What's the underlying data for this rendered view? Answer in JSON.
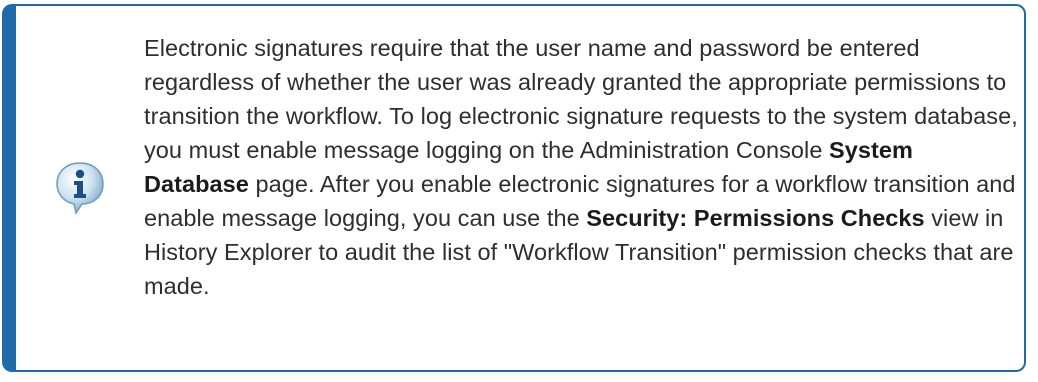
{
  "note": {
    "icon": "info-speech-bubble-icon",
    "accent_color": "#1f6aa8",
    "segments": [
      "Electronic signatures require that the user name and password be entered regardless of whether the user was already granted the appropriate permissions to transition the workflow. To log electronic signature requests to the system database, you must enable message logging on the Administration Console ",
      "System Database",
      " page. After you enable electronic signatures for a workflow transition and enable message logging, you can use the ",
      "Security: Permissions Checks",
      " view in History Explorer to audit the list of \"Workflow Transition\" permission checks that are made."
    ]
  }
}
